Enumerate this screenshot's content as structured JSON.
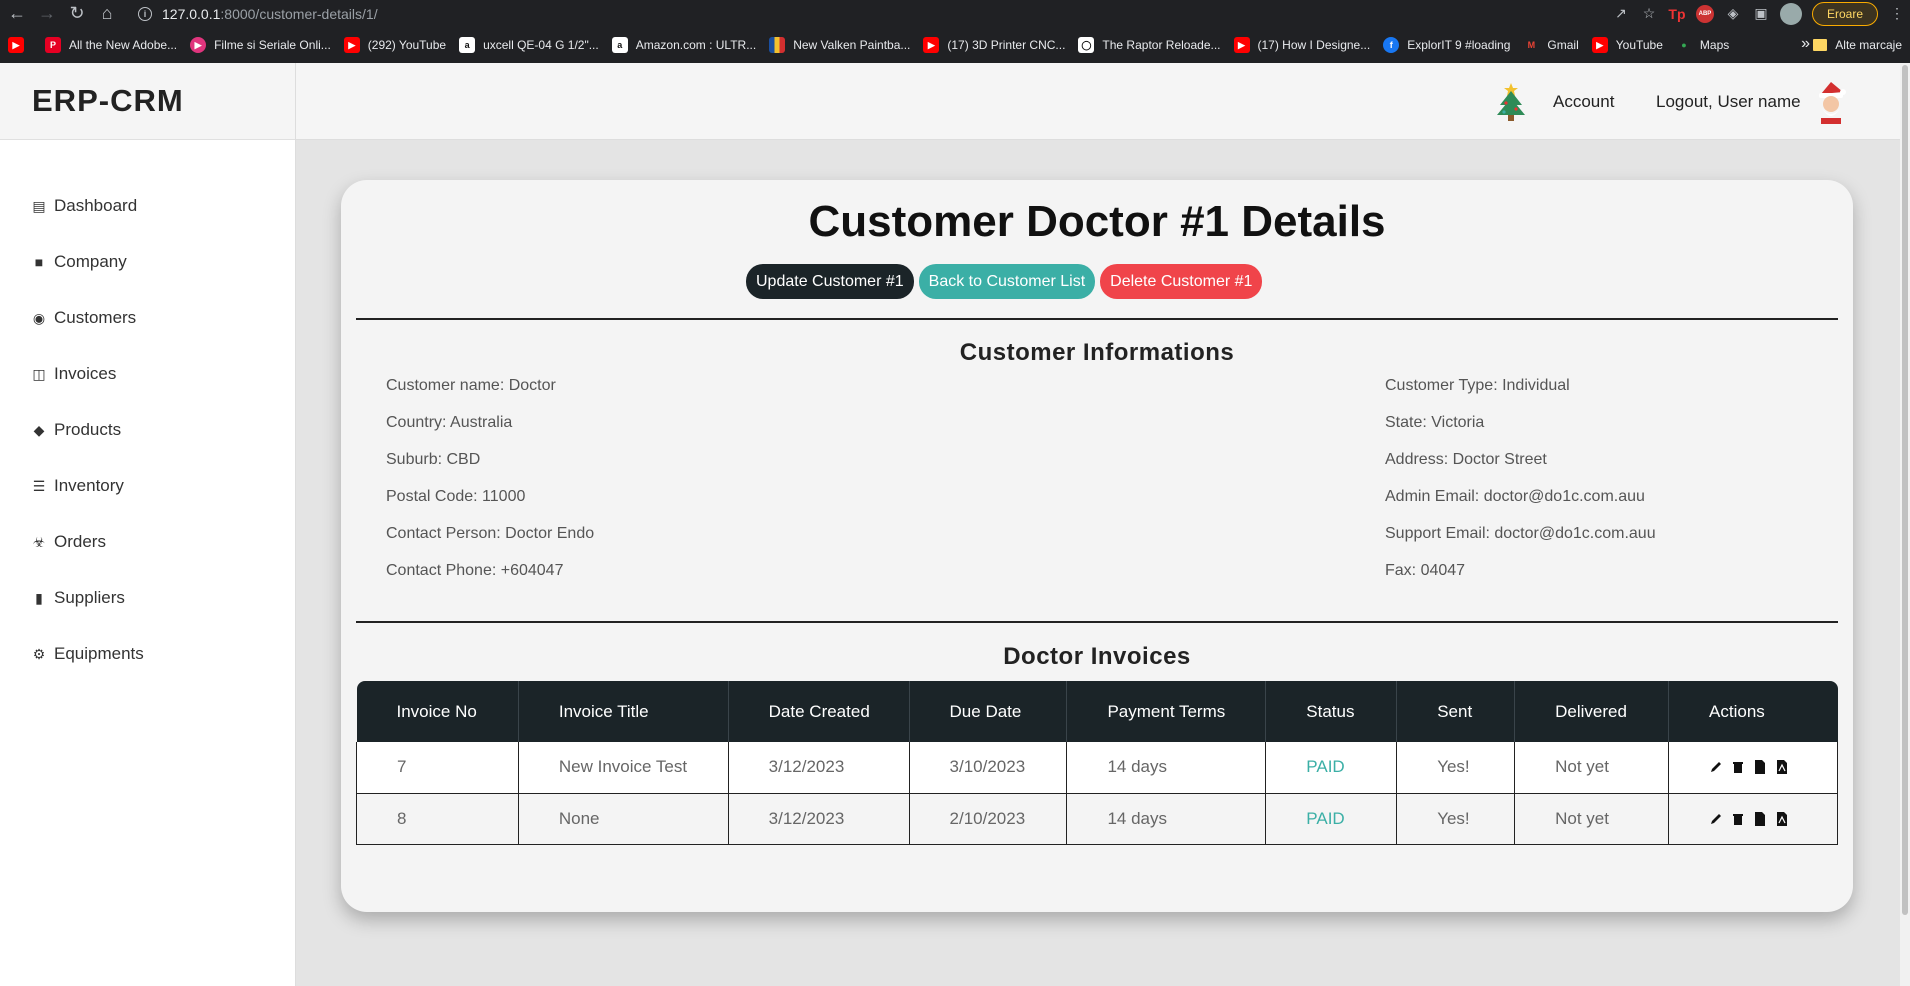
{
  "browser": {
    "url_host": "127.0.0.1",
    "url_path": ":8000/customer-details/1/",
    "error_label": "Eroare",
    "bookmarks": [
      {
        "label": "",
        "icon": "youtube-icon",
        "color": "#ff0000"
      },
      {
        "label": "All the New Adobe...",
        "icon": "pinterest-icon",
        "color": "#e60023"
      },
      {
        "label": "Filme si Seriale Onli...",
        "icon": "play-icon",
        "color": "#e0357d"
      },
      {
        "label": "(292) YouTube",
        "icon": "youtube-icon",
        "color": "#ff0000"
      },
      {
        "label": "uxcell QE-04 G 1/2\"...",
        "icon": "amazon-icon",
        "color": "#ffffff"
      },
      {
        "label": "Amazon.com : ULTR...",
        "icon": "amazon-icon",
        "color": "#ffffff"
      },
      {
        "label": "New Valken Paintba...",
        "icon": "bars-icon",
        "color": "#f2c12e"
      },
      {
        "label": "(17) 3D Printer CNC...",
        "icon": "youtube-icon",
        "color": "#ff0000"
      },
      {
        "label": "The Raptor Reloade...",
        "icon": "site-icon",
        "color": "#ffffff"
      },
      {
        "label": "(17) How I Designe...",
        "icon": "youtube-icon",
        "color": "#ff0000"
      },
      {
        "label": "ExplorIT 9 #loading",
        "icon": "facebook-icon",
        "color": "#1877f2"
      },
      {
        "label": "Gmail",
        "icon": "gmail-icon",
        "color": "#ea4335"
      },
      {
        "label": "YouTube",
        "icon": "youtube-icon",
        "color": "#ff0000"
      },
      {
        "label": "Maps",
        "icon": "maps-icon",
        "color": "#34a853"
      }
    ],
    "other_bookmarks": "Alte marcaje"
  },
  "app": {
    "brand": "ERP-CRM",
    "account": "Account",
    "logout": "Logout, User name"
  },
  "sidebar": {
    "items": [
      {
        "label": "Dashboard",
        "icon": "chart-icon"
      },
      {
        "label": "Company",
        "icon": "folder-icon"
      },
      {
        "label": "Customers",
        "icon": "user-circle-icon"
      },
      {
        "label": "Invoices",
        "icon": "folder-open-icon"
      },
      {
        "label": "Products",
        "icon": "tags-icon"
      },
      {
        "label": "Inventory",
        "icon": "server-icon"
      },
      {
        "label": "Orders",
        "icon": "cart-icon"
      },
      {
        "label": "Suppliers",
        "icon": "truck-icon"
      },
      {
        "label": "Equipments",
        "icon": "cogs-icon"
      }
    ]
  },
  "main": {
    "title": "Customer Doctor #1 Details",
    "buttons": {
      "update": "Update Customer #1",
      "back": "Back to Customer List",
      "delete": "Delete Customer #1"
    },
    "info_title": "Customer Informations",
    "info_left": [
      "Customer name: Doctor",
      "Country: Australia",
      "Suburb: CBD",
      "Postal Code: 11000",
      "Contact Person: Doctor Endo",
      "Contact Phone: +604047"
    ],
    "info_right": [
      "Customer Type: Individual",
      "State: Victoria",
      "Address: Doctor Street",
      "Admin Email: doctor@do1c.com.auu",
      "Support Email: doctor@do1c.com.auu",
      "Fax: 04047"
    ],
    "invoices_title": "Doctor Invoices",
    "table": {
      "headers": [
        "Invoice No",
        "Invoice Title",
        "Date Created",
        "Due Date",
        "Payment Terms",
        "Status",
        "Sent",
        "Delivered",
        "Actions"
      ],
      "rows": [
        [
          "7",
          "New Invoice Test",
          "3/12/2023",
          "3/10/2023",
          "14 days",
          "PAID",
          "Yes!",
          "Not yet"
        ],
        [
          "8",
          "None",
          "3/12/2023",
          "2/10/2023",
          "14 days",
          "PAID",
          "Yes!",
          "Not yet"
        ]
      ]
    }
  },
  "colors": {
    "accent_teal": "#3bafa6",
    "accent_red": "#f0444a",
    "dark": "#1b2428"
  }
}
